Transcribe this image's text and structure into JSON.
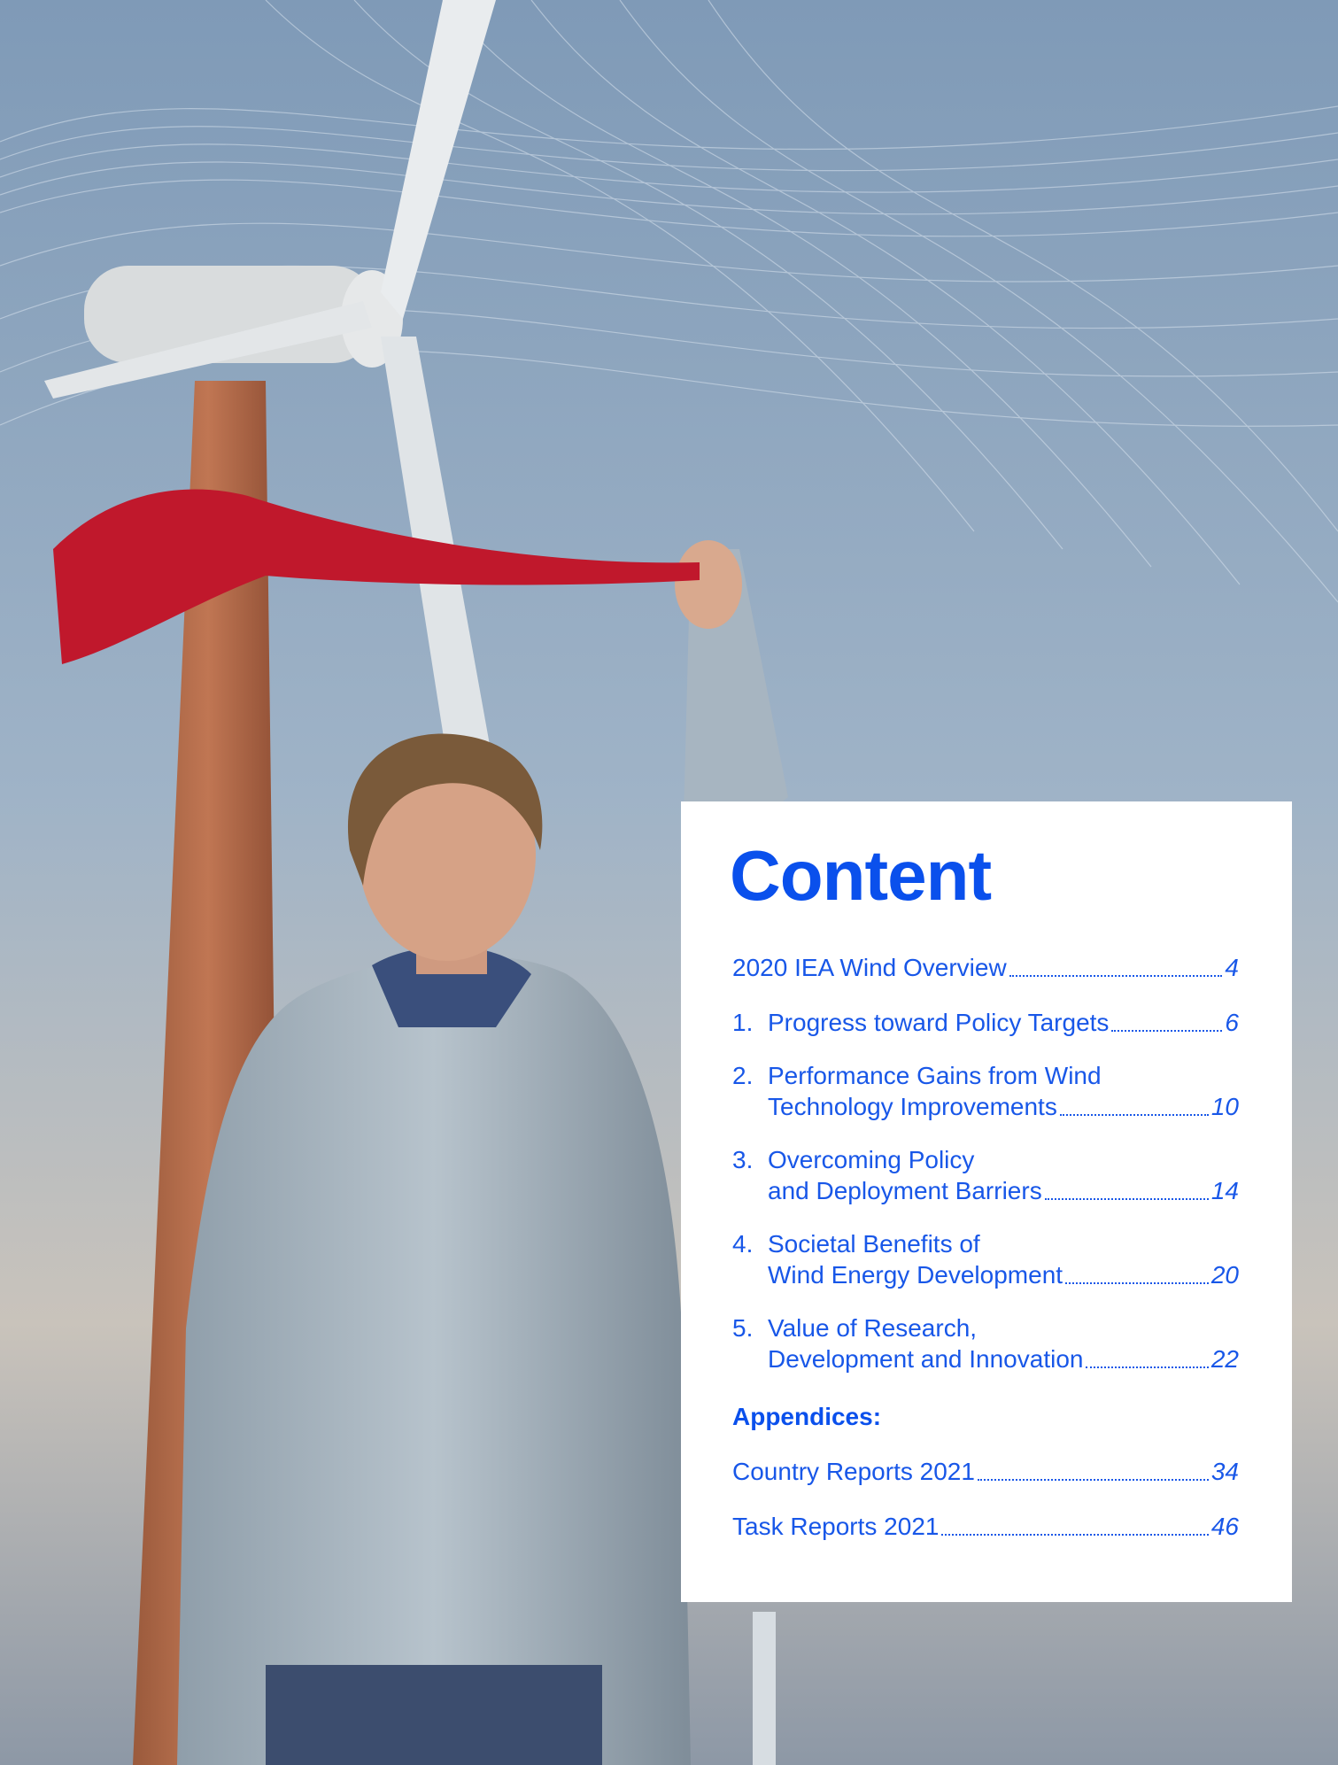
{
  "toc": {
    "title": "Content",
    "overview": {
      "text": "2020 IEA Wind Overview",
      "page": "4"
    },
    "sections": [
      {
        "num": "1.",
        "line1": "",
        "line2": "Progress toward Policy Targets",
        "page": "6"
      },
      {
        "num": "2.",
        "line1": "Performance Gains from Wind",
        "line2": "Technology Improvements",
        "page": "10"
      },
      {
        "num": "3.",
        "line1": "Overcoming Policy",
        "line2": "and Deployment Barriers",
        "page": "14"
      },
      {
        "num": "4.",
        "line1": "Societal Benefits of",
        "line2": "Wind Energy Development",
        "page": "20"
      },
      {
        "num": "5.",
        "line1": "Value of Research,",
        "line2": "Development and Innovation",
        "page": "22"
      }
    ],
    "appendices_heading": "Appendices:",
    "appendices": [
      {
        "text": "Country Reports 2021",
        "page": "34"
      },
      {
        "text": "Task Reports 2021",
        "page": "46"
      }
    ]
  },
  "photo": {
    "subject": "woman-with-red-bandana-wind-turbines-photo",
    "sky_color": "#8aa3bd",
    "bandana_color": "#c0182c",
    "jacket_color": "#a9b8c6"
  }
}
